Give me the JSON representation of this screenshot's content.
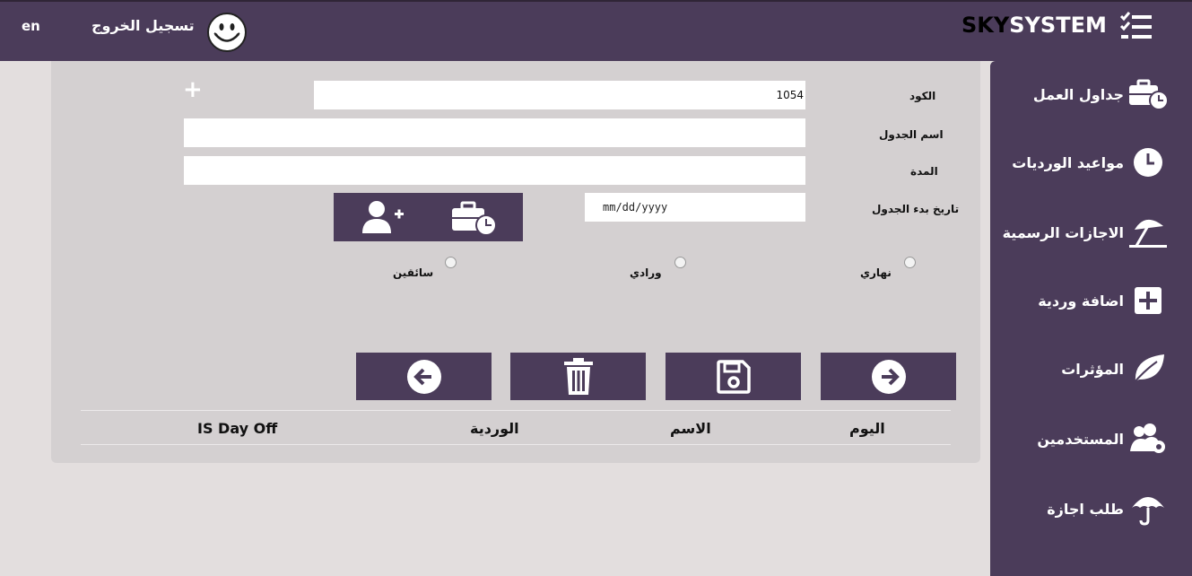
{
  "header": {
    "lang": "en",
    "logout_label": "تسجيل الخروج",
    "brand_part1": "SKY",
    "brand_part2": "SYSTEM"
  },
  "sidebar": {
    "items": [
      {
        "label": "جداول العمل",
        "icon": "briefcase-clock-icon"
      },
      {
        "label": "مواعيد الورديات",
        "icon": "clock-icon"
      },
      {
        "label": "الاجازات الرسمية",
        "icon": "beach-umbrella-icon"
      },
      {
        "label": "اضافة وردية",
        "icon": "plus-square-icon"
      },
      {
        "label": "المؤثرات",
        "icon": "leaf-icon"
      },
      {
        "label": "المستخدمين",
        "icon": "users-gear-icon"
      },
      {
        "label": "طلب اجازة",
        "icon": "umbrella-icon"
      }
    ]
  },
  "form": {
    "code_label": "الكود",
    "code_value": "1054",
    "name_label": "اسم الجدول",
    "name_value": "",
    "duration_label": "المدة",
    "duration_value": "",
    "start_date_label": "تاريخ بدء الجدول",
    "start_date_placeholder": "mm/dd/yyyy"
  },
  "radios": {
    "day": "نهاري",
    "wardi": "ورادي",
    "drivers": "سائقين"
  },
  "table": {
    "columns": [
      "اليوم",
      "الاسم",
      "الوردية",
      "IS Day Off"
    ]
  },
  "colors": {
    "accent": "#4b3c5a",
    "panel": "#d4d0d1",
    "background": "#e3dede"
  }
}
